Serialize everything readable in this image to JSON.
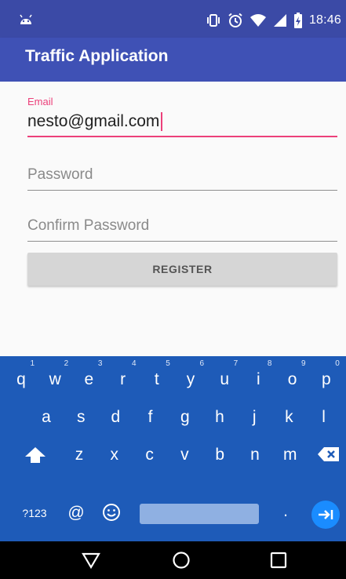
{
  "status_bar": {
    "time": "18:46",
    "icons": [
      "android-notification-icon",
      "vibrate-icon",
      "alarm-icon",
      "wifi-icon",
      "cellular-signal-icon",
      "battery-icon"
    ]
  },
  "app_bar": {
    "title": "Traffic Application",
    "color": "#3f51b5"
  },
  "form": {
    "email": {
      "label": "Email",
      "value": "nesto@gmail.com"
    },
    "password": {
      "placeholder": "Password"
    },
    "confirm_password": {
      "placeholder": "Confirm Password"
    },
    "register_label": "REGISTER"
  },
  "keyboard": {
    "row1": [
      {
        "key": "q",
        "hint": "1"
      },
      {
        "key": "w",
        "hint": "2"
      },
      {
        "key": "e",
        "hint": "3"
      },
      {
        "key": "r",
        "hint": "4"
      },
      {
        "key": "t",
        "hint": "5"
      },
      {
        "key": "y",
        "hint": "6"
      },
      {
        "key": "u",
        "hint": "7"
      },
      {
        "key": "i",
        "hint": "8"
      },
      {
        "key": "o",
        "hint": "9"
      },
      {
        "key": "p",
        "hint": "0"
      }
    ],
    "row2": [
      "a",
      "s",
      "d",
      "f",
      "g",
      "h",
      "j",
      "k",
      "l"
    ],
    "row3": [
      "z",
      "x",
      "c",
      "v",
      "b",
      "n",
      "m"
    ],
    "symbols_label": "?123",
    "at_label": "@",
    "period_label": ".",
    "color": "#1e5bb8"
  },
  "accent_color": "#ec407a"
}
